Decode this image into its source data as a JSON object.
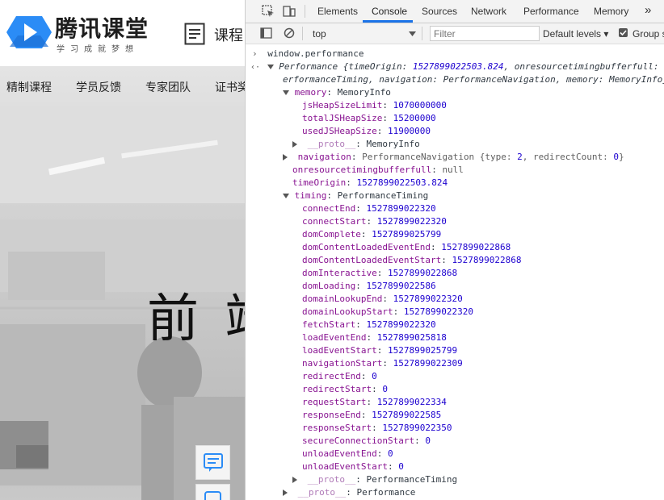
{
  "page": {
    "logo_title": "腾讯课堂",
    "logo_slogan": "学习成就梦想",
    "course_label": "课程",
    "nav": [
      "精制课程",
      "学员反馈",
      "专家团队",
      "证书奖"
    ],
    "hero_text": "前 端"
  },
  "devtools": {
    "tabs": [
      "Elements",
      "Console",
      "Sources",
      "Network",
      "Performance",
      "Memory"
    ],
    "active_tab": "Console",
    "more_tabs": "»",
    "context": "top",
    "filter_placeholder": "Filter",
    "levels": "Default levels ▾",
    "group_similar": "Group s",
    "group_checked": true
  },
  "console": {
    "input": "window.performance",
    "summary_1_a": "Performance {timeOrigin: ",
    "summary_1_b": "1527899022503.824",
    "summary_1_c": ", onresourcetimingbufferfull: ",
    "summary_2": "erformanceTiming, navigation: PerformanceNavigation, memory: MemoryInfo}",
    "memory_key": "memory",
    "memory_type": "MemoryInfo",
    "memory_fields": [
      {
        "k": "jsHeapSizeLimit",
        "v": "1070000000"
      },
      {
        "k": "totalJSHeapSize",
        "v": "15200000"
      },
      {
        "k": "usedJSHeapSize",
        "v": "11900000"
      }
    ],
    "proto_key": "__proto__",
    "memory_proto": "MemoryInfo",
    "navigation_key": "navigation",
    "navigation_a": "PerformanceNavigation {type: ",
    "navigation_type": "2",
    "navigation_b": ", redirectCount: ",
    "navigation_redirect": "0",
    "navigation_c": "}",
    "onres_key": "onresourcetimingbufferfull",
    "onres_val": "null",
    "timeorigin_key": "timeOrigin",
    "timeorigin_val": "1527899022503.824",
    "timing_key": "timing",
    "timing_type": "PerformanceTiming",
    "timing_fields": [
      {
        "k": "connectEnd",
        "v": "1527899022320"
      },
      {
        "k": "connectStart",
        "v": "1527899022320"
      },
      {
        "k": "domComplete",
        "v": "1527899025799"
      },
      {
        "k": "domContentLoadedEventEnd",
        "v": "1527899022868"
      },
      {
        "k": "domContentLoadedEventStart",
        "v": "1527899022868"
      },
      {
        "k": "domInteractive",
        "v": "1527899022868"
      },
      {
        "k": "domLoading",
        "v": "1527899022586"
      },
      {
        "k": "domainLookupEnd",
        "v": "1527899022320"
      },
      {
        "k": "domainLookupStart",
        "v": "1527899022320"
      },
      {
        "k": "fetchStart",
        "v": "1527899022320"
      },
      {
        "k": "loadEventEnd",
        "v": "1527899025818"
      },
      {
        "k": "loadEventStart",
        "v": "1527899025799"
      },
      {
        "k": "navigationStart",
        "v": "1527899022309"
      },
      {
        "k": "redirectEnd",
        "v": "0"
      },
      {
        "k": "redirectStart",
        "v": "0"
      },
      {
        "k": "requestStart",
        "v": "1527899022334"
      },
      {
        "k": "responseEnd",
        "v": "1527899022585"
      },
      {
        "k": "responseStart",
        "v": "1527899022350"
      },
      {
        "k": "secureConnectionStart",
        "v": "0"
      },
      {
        "k": "unloadEventEnd",
        "v": "0"
      },
      {
        "k": "unloadEventStart",
        "v": "0"
      }
    ],
    "timing_proto": "PerformanceTiming",
    "root_proto": "Performance"
  },
  "colors": {
    "accent": "#1a73e8",
    "key": "#881391",
    "number": "#1c00cf",
    "logo_blue": "#2b8cf6"
  }
}
